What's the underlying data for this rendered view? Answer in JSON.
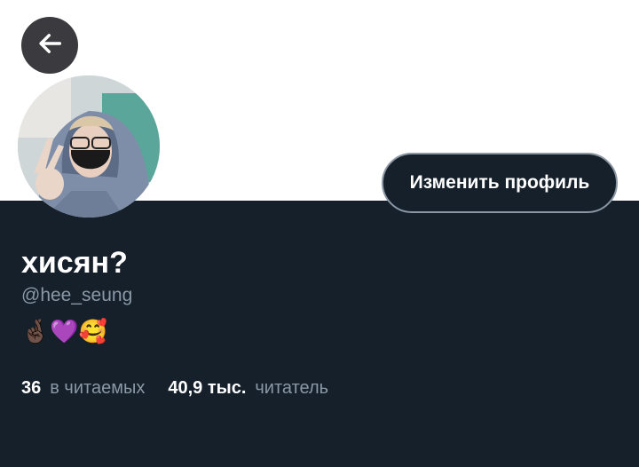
{
  "profile": {
    "display_name": "хисян?",
    "handle": "@hee_seung",
    "bio": "🤞🏿💜🥰",
    "edit_button_label": "Изменить профиль"
  },
  "stats": {
    "following_count": "36",
    "following_label": "в читаемых",
    "followers_count": "40,9 тыс.",
    "followers_label": "читатель"
  },
  "icons": {
    "back": "arrow-left-icon"
  },
  "colors": {
    "background": "#15202b",
    "banner": "#ffffff",
    "text_primary": "#ffffff",
    "text_secondary": "#8b98a5",
    "button_border": "#8a97a3",
    "back_button_bg": "#3b3b3f"
  }
}
